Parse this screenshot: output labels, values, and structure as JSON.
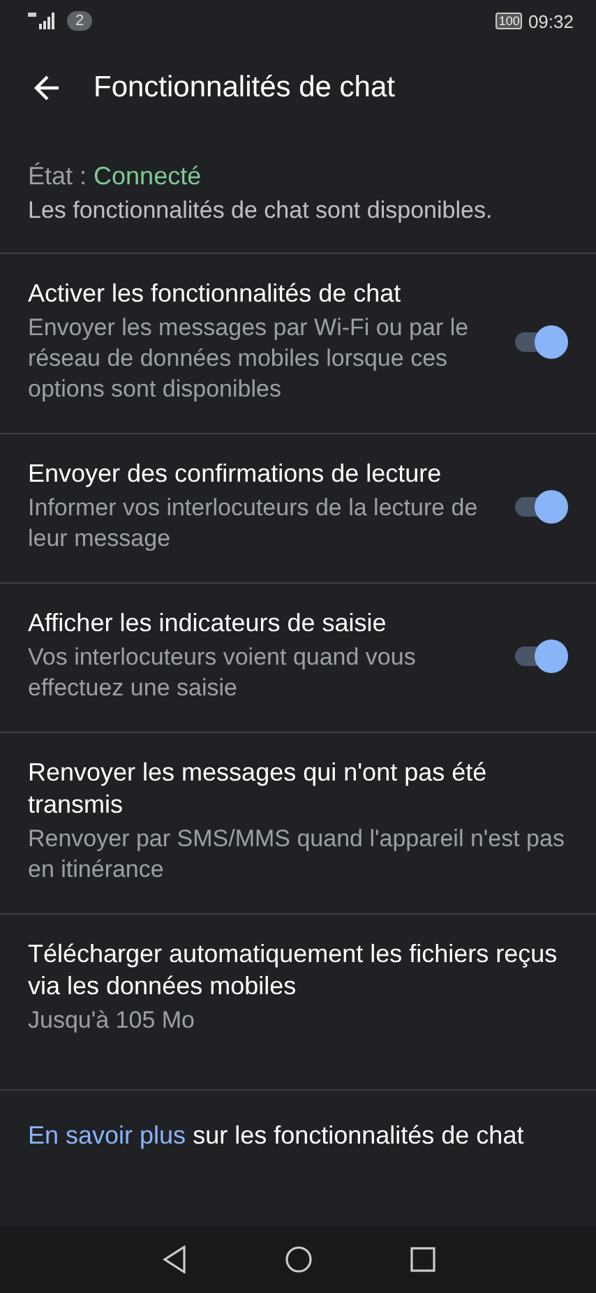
{
  "status_bar": {
    "notification_count": "2",
    "battery": "100",
    "time": "09:32"
  },
  "app_bar": {
    "title": "Fonctionnalités de chat"
  },
  "status": {
    "label": "État :",
    "value": "Connecté",
    "description": "Les fonctionnalités de chat sont disponibles."
  },
  "settings": [
    {
      "kind": "toggle",
      "title": "Activer les fonctionnalités de chat",
      "summary": "Envoyer les messages par Wi-Fi ou par le réseau de données mobiles lorsque ces options sont disponibles",
      "on": true
    },
    {
      "kind": "toggle",
      "title": "Envoyer des confirmations de lecture",
      "summary": "Informer vos interlocuteurs de la lecture de leur message",
      "on": true
    },
    {
      "kind": "toggle",
      "title": "Afficher les indicateurs de saisie",
      "summary": "Vos interlocuteurs voient quand vous effectuez une saisie",
      "on": true
    },
    {
      "kind": "plain",
      "title": "Renvoyer les messages qui n'ont pas été transmis",
      "summary": "Renvoyer par SMS/MMS quand l'appareil n'est pas en itinérance"
    },
    {
      "kind": "plain",
      "title": "Télécharger automatiquement les fichiers reçus via les données mobiles",
      "summary": "Jusqu'à 105 Mo"
    }
  ],
  "footer": {
    "link": "En savoir plus",
    "text": "sur les fonctionnalités de chat"
  }
}
